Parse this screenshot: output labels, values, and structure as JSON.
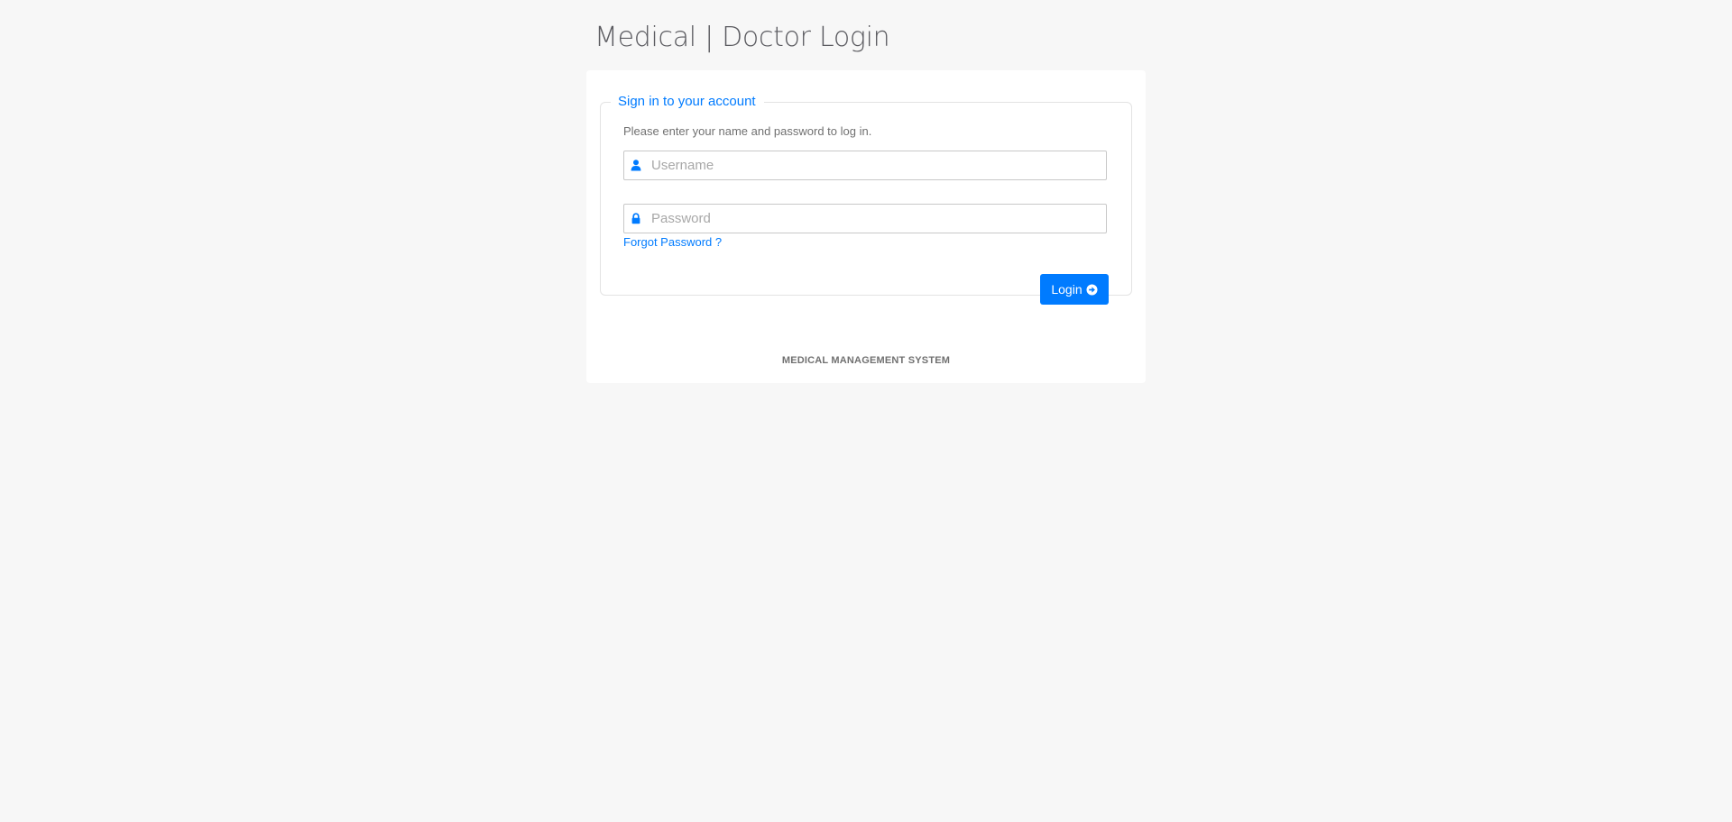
{
  "header": {
    "title": "Medical | Doctor Login"
  },
  "login_form": {
    "legend": "Sign in to your account",
    "instruction": "Please enter your name and password to log in.",
    "username": {
      "placeholder": "Username",
      "value": "",
      "icon": "user-icon"
    },
    "password": {
      "placeholder": "Password",
      "value": "",
      "icon": "lock-icon"
    },
    "forgot_link": "Forgot Password ?",
    "login_button": {
      "label": "Login",
      "icon": "arrow-circle-right-icon"
    }
  },
  "footer": {
    "text": "MEDICAL MANAGEMENT SYSTEM"
  },
  "colors": {
    "accent": "#007bff",
    "background": "#f7f7f7",
    "panel": "#ffffff"
  }
}
